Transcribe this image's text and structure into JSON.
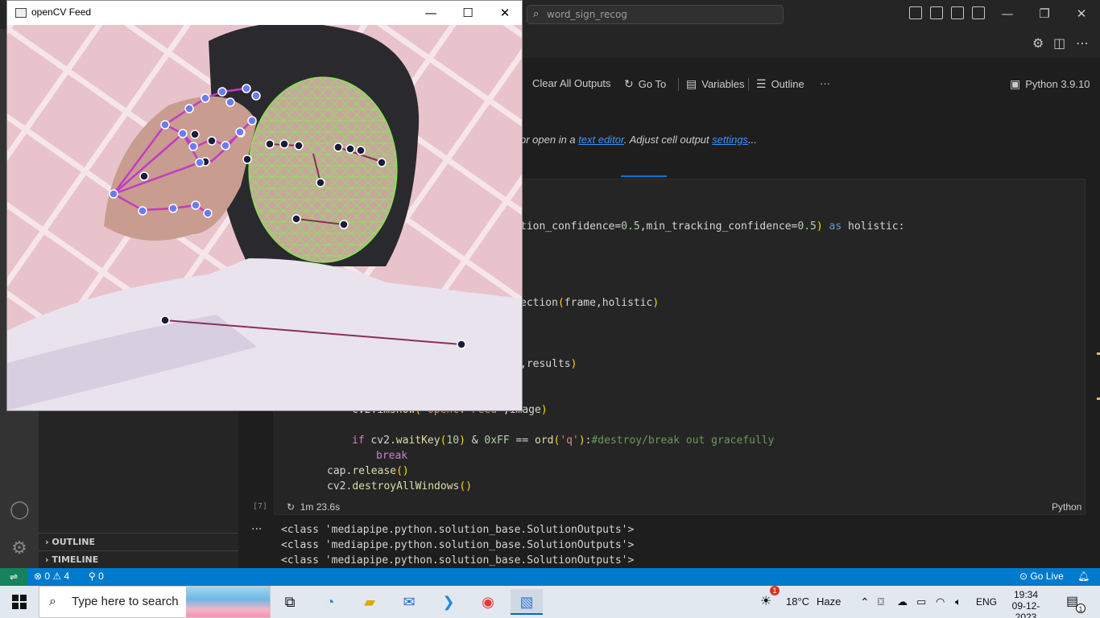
{
  "vscode": {
    "search_text": "word_sign_recog",
    "window_controls": [
      "—",
      "❐",
      "✕"
    ]
  },
  "notebook_toolbar": {
    "clear_all_outputs": "Clear All Outputs",
    "go_to": "Go To",
    "variables": "Variables",
    "outline": "Outline",
    "more": "···",
    "kernel": "Python 3.9.10"
  },
  "message": {
    "prefix": "or open in a ",
    "link1": "text editor",
    "middle": ". Adjust cell output ",
    "link2": "settings",
    "suffix": "..."
  },
  "cell": {
    "execution_count": "[7]",
    "execution_time": "1m 23.6s",
    "language": "Python"
  },
  "outputs": [
    "<class 'mediapipe.python.solution_base.SolutionOutputs'>",
    "<class 'mediapipe.python.solution_base.SolutionOutputs'>",
    "<class 'mediapipe.python.solution_base.SolutionOutputs'>"
  ],
  "output_more": "···",
  "sidebar": {
    "outline": "OUTLINE",
    "timeline": "TIMELINE"
  },
  "statusbar": {
    "errors": "0",
    "warnings": "4",
    "ports": "0",
    "go_live": "Go Live"
  },
  "taskbar": {
    "search_placeholder": "Type here to search",
    "weather_temp": "18°C",
    "weather_cond": "Haze",
    "weather_badge": "1",
    "language": "ENG",
    "time": "19:34",
    "date": "09-12-2023",
    "notification_count": "1"
  },
  "opencv_window": {
    "title": "openCV Feed"
  }
}
